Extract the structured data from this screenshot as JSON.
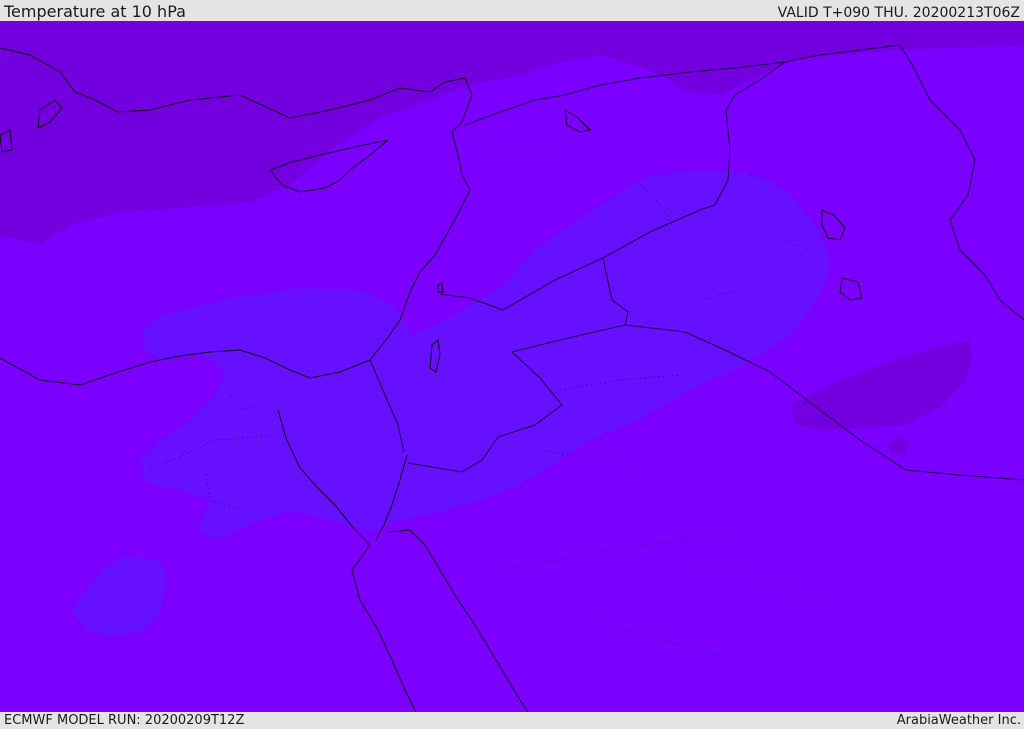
{
  "header": {
    "title": "Temperature at 10 hPa",
    "valid": "VALID T+090 THU. 20200213T06Z"
  },
  "footer": {
    "model_run": "ECMWF MODEL RUN: 20200209T12Z",
    "credit": "ArabiaWeather Inc."
  },
  "map": {
    "colors": {
      "base": "#7b00ff",
      "cold_north": "#7100d9",
      "cool_band": "#6412ff",
      "coast": "#111111",
      "border": "#1c0a3c"
    },
    "shading": [
      "cold_north",
      "cool_band",
      "base"
    ],
    "legend_visible": false,
    "gridlines": false
  }
}
